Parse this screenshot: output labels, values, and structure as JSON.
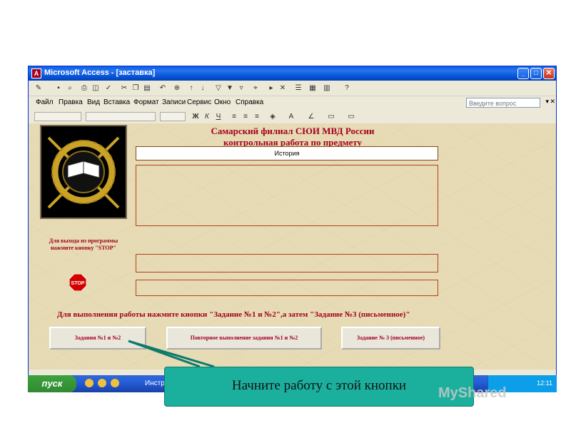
{
  "window": {
    "title": "Microsoft Access - [заставка]",
    "app_icon": "access-icon",
    "controls": [
      "minimize",
      "maximize",
      "close"
    ]
  },
  "menubar": {
    "items": [
      "Файл",
      "Правка",
      "Вид",
      "Вставка",
      "Формат",
      "Записи",
      "Сервис",
      "Окно",
      "Справка"
    ],
    "help_placeholder": "Введите вопрос"
  },
  "form": {
    "heading_line1": "Самарский филиал СЮИ МВД России",
    "heading_line2": "контрольная работа по предмету",
    "subject_value": "История",
    "exit_hint": "Для выхода из программы нажмите кнопку \"STOP\"",
    "stop_label": "STOP",
    "instruction": "Для выполнения работы нажмите кнопки   \"Задание №1 и №2\",а затем \"Задание №3 (письменное)\"",
    "buttons": {
      "task12": "Задания   №1 и №2",
      "repeat": "Повторное выполнение задания №1 и №2",
      "task3": "Задание № 3 (письменное)"
    },
    "colors": {
      "heading": "#a3001f",
      "background": "#e6dbb4"
    }
  },
  "taskbar": {
    "start_label": "пуск",
    "task_label": "Инстру",
    "clock": "12:11"
  },
  "callout": {
    "text": "Начните работу с этой кнопки",
    "color": "#1bb09e"
  },
  "watermark": "MyShared"
}
